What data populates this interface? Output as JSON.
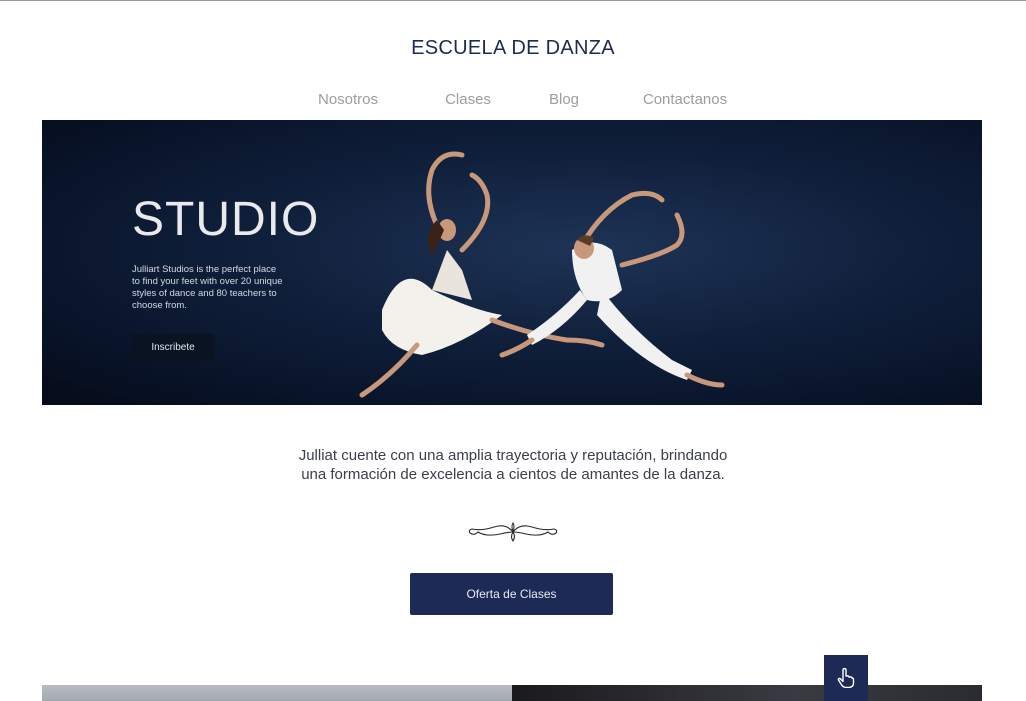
{
  "header": {
    "site_title": "ESCUELA DE DANZA",
    "nav": [
      "Nosotros",
      "Clases",
      "Blog",
      "Contactanos"
    ]
  },
  "hero": {
    "title": "STUDIO",
    "description": "Julliart Studios is the perfect place to find your feet with over 20 unique styles of dance and 80 teachers to choose from.",
    "cta_label": "Inscribete"
  },
  "intro": {
    "line1": "Julliat cuente con una amplia trayectoria y reputación, brindando",
    "line2": "una formación de excelencia a cientos de amantes de la danza."
  },
  "main_button_label": "Oferta de Clases",
  "colors": {
    "brand_navy": "#1c2a55",
    "nav_gray": "#9d9d9d",
    "hero_dark": "#09142a"
  },
  "icons": {
    "ornament": "decorative-flourish-icon",
    "fab": "hand-pointer-icon"
  }
}
